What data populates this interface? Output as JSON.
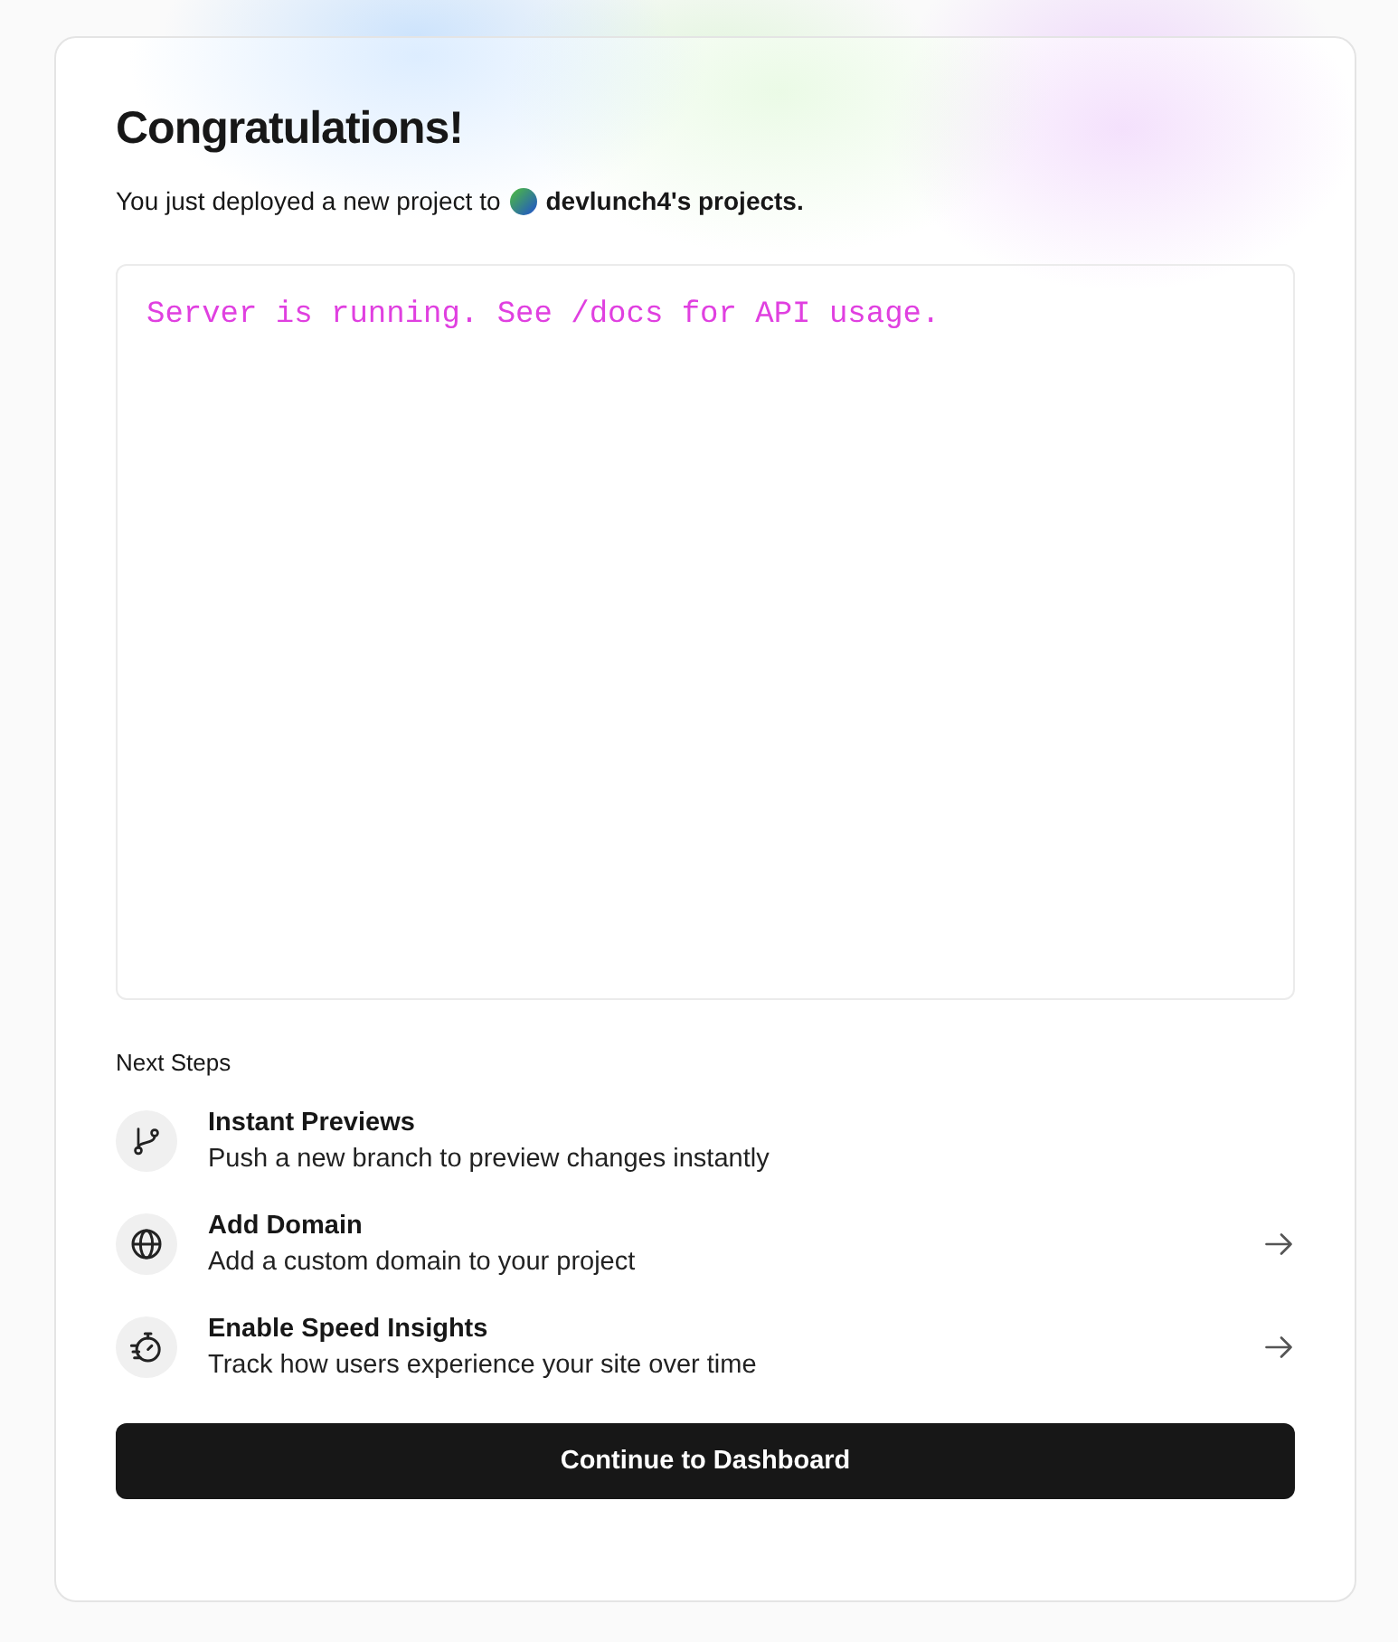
{
  "title": "Congratulations!",
  "subtitle": {
    "before": "You just deployed a new project to",
    "team": "devlunch4's projects."
  },
  "preview": {
    "text": "Server is running. See /docs for API usage."
  },
  "next_steps": {
    "heading": "Next Steps",
    "items": [
      {
        "kind": "branch",
        "title": "Instant Previews",
        "description": "Push a new branch to preview changes instantly",
        "arrow": false
      },
      {
        "kind": "globe",
        "title": "Add Domain",
        "description": "Add a custom domain to your project",
        "arrow": true
      },
      {
        "kind": "stopwatch",
        "title": "Enable Speed Insights",
        "description": "Track how users experience your site over time",
        "arrow": true
      }
    ]
  },
  "button": "Continue to Dashboard"
}
